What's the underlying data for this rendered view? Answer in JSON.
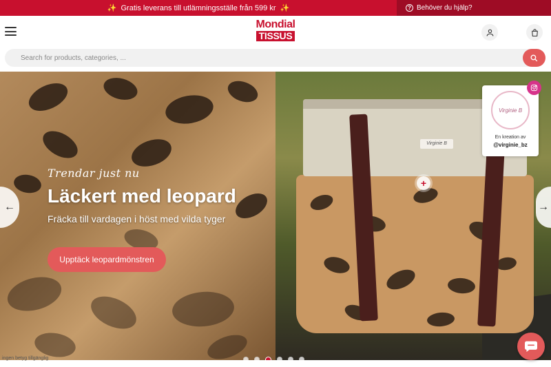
{
  "announcement": {
    "promo_text": "Gratis leverans till utlämningsställe från 599 kr",
    "sparkle_icon": "sparkle-icon",
    "help_text": "Behöver du hjälp?"
  },
  "header": {
    "logo_top": "Mondial",
    "logo_bottom": "TISSUS",
    "menu_icon": "hamburger-icon",
    "account_icon": "user-icon",
    "cart_icon": "shopping-bag-icon"
  },
  "search": {
    "placeholder": "Search for products, categories, ...",
    "button_icon": "search-icon"
  },
  "hero": {
    "eyebrow": "Trendar just nu",
    "headline": "Läckert med leopard",
    "subline": "Fräcka till vardagen i höst med vilda tyger",
    "cta_label": "Upptäck leopardmönstren",
    "bag_tag": "Virginie B",
    "creator_logo": "Virginie B",
    "creator_by": "En kreation av",
    "creator_handle": "@virginie_bz",
    "slide_count": 6,
    "active_slide": 3
  },
  "footer": {
    "partial_text": "ingen betyg tillgänglig"
  },
  "colors": {
    "brand_red": "#c8102e",
    "accent_coral": "#e35a5a"
  }
}
